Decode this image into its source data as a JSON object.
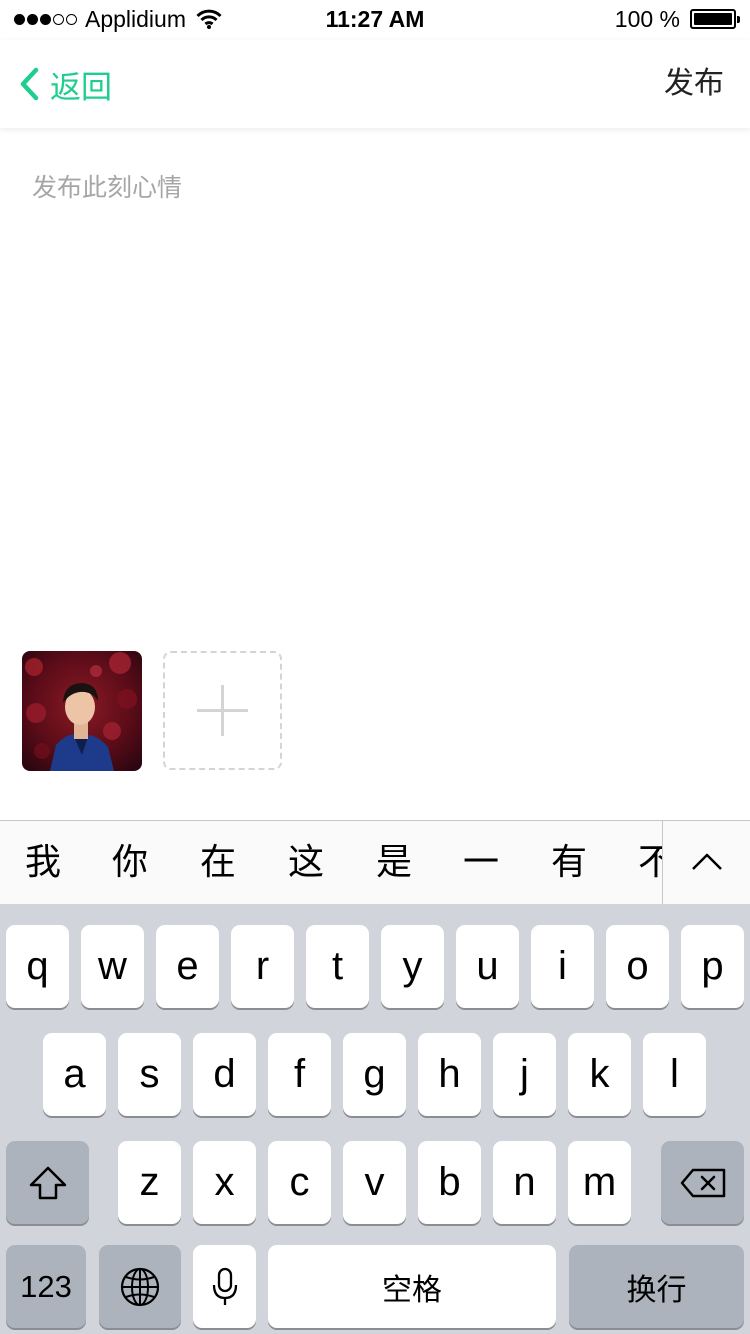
{
  "status_bar": {
    "carrier": "Applidium",
    "time": "11:27 AM",
    "battery": "100 %",
    "battery_level": 1.0,
    "signal_bars_filled": 3,
    "signal_bars_total": 5
  },
  "nav": {
    "back_label": "返回",
    "publish_label": "发布"
  },
  "composer": {
    "placeholder": "发布此刻心情",
    "value": ""
  },
  "photos": {
    "add_icon": "plus-icon"
  },
  "candidates": [
    "我",
    "你",
    "在",
    "这",
    "是",
    "一",
    "有",
    "不"
  ],
  "keyboard": {
    "row1": [
      "q",
      "w",
      "e",
      "r",
      "t",
      "y",
      "u",
      "i",
      "o",
      "p"
    ],
    "row2": [
      "a",
      "s",
      "d",
      "f",
      "g",
      "h",
      "j",
      "k",
      "l"
    ],
    "row3": [
      "z",
      "x",
      "c",
      "v",
      "b",
      "n",
      "m"
    ],
    "numbers_label": "123",
    "space_label": "空格",
    "return_label": "换行"
  },
  "colors": {
    "accent": "#1fce8e",
    "keyboard_bg": "#d1d5db",
    "function_key": "#adb3bc"
  }
}
